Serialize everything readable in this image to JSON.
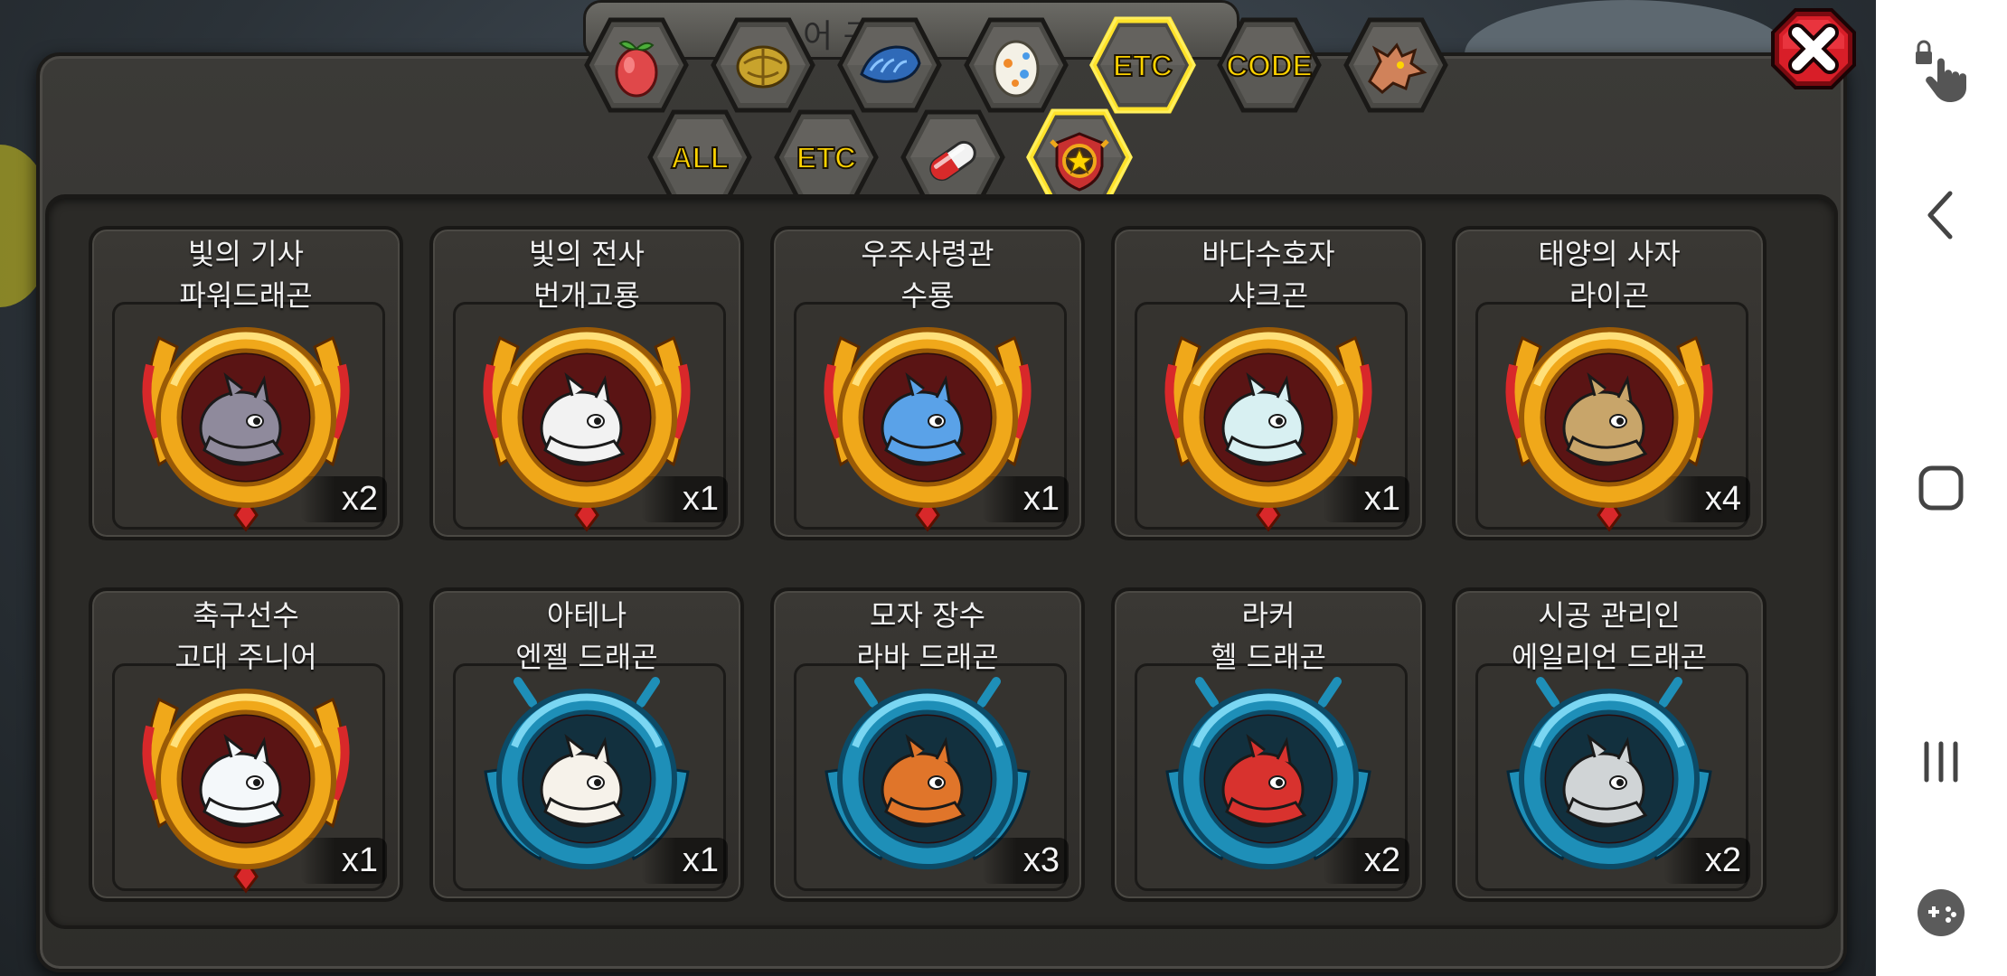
{
  "header_partial_text": "어 구",
  "tabs_row1": [
    {
      "name": "tab-fruit",
      "icon": "fruit-icon",
      "label": "",
      "selected": false
    },
    {
      "name": "tab-nuts",
      "icon": "nuts-icon",
      "label": "",
      "selected": false
    },
    {
      "name": "tab-scales",
      "icon": "scales-icon",
      "label": "",
      "selected": false
    },
    {
      "name": "tab-egg",
      "icon": "egg-icon",
      "label": "",
      "selected": false
    },
    {
      "name": "tab-etc-top",
      "icon": "",
      "label": "ETC",
      "selected": true
    },
    {
      "name": "tab-code",
      "icon": "",
      "label": "CODE",
      "selected": false
    },
    {
      "name": "tab-dragon",
      "icon": "dragon-head-icon",
      "label": "",
      "selected": false
    }
  ],
  "tabs_row2": [
    {
      "name": "tab-all",
      "icon": "",
      "label": "ALL",
      "selected": false
    },
    {
      "name": "tab-etc",
      "icon": "",
      "label": "ETC",
      "selected": false
    },
    {
      "name": "tab-capsule",
      "icon": "capsule-icon",
      "label": "",
      "selected": false
    },
    {
      "name": "tab-star-badge",
      "icon": "star-badge-icon",
      "label": "",
      "selected": true
    }
  ],
  "items": [
    {
      "title": "빛의 기사",
      "subtitle": "파워드래곤",
      "count": "x2",
      "frame": "gold",
      "creature_color": "#8f8a9c"
    },
    {
      "title": "빛의 전사",
      "subtitle": "번개고룡",
      "count": "x1",
      "frame": "gold",
      "creature_color": "#f2f2f2"
    },
    {
      "title": "우주사령관",
      "subtitle": "수룡",
      "count": "x1",
      "frame": "gold",
      "creature_color": "#5aa2e8"
    },
    {
      "title": "바다수호자",
      "subtitle": "샤크곤",
      "count": "x1",
      "frame": "gold",
      "creature_color": "#d8f0f2"
    },
    {
      "title": "태양의 사자",
      "subtitle": "라이곤",
      "count": "x4",
      "frame": "gold",
      "creature_color": "#c8a56a"
    },
    {
      "title": "축구선수",
      "subtitle": "고대 주니어",
      "count": "x1",
      "frame": "gold",
      "creature_color": "#f4f8fa"
    },
    {
      "title": "아테나",
      "subtitle": "엔젤 드래곤",
      "count": "x1",
      "frame": "blue",
      "creature_color": "#f6f2ea"
    },
    {
      "title": "모자 장수",
      "subtitle": "라바 드래곤",
      "count": "x3",
      "frame": "blue",
      "creature_color": "#e0752a"
    },
    {
      "title": "라커",
      "subtitle": "헬 드래곤",
      "count": "x2",
      "frame": "blue",
      "creature_color": "#d8322e"
    },
    {
      "title": "시공 관리인",
      "subtitle": "에일리언 드래곤",
      "count": "x2",
      "frame": "blue",
      "creature_color": "#d0d4d6"
    }
  ],
  "colors": {
    "gold_frame": "#f0a81a",
    "blue_frame": "#1e8fb8",
    "selected_glow": "#ffe22a",
    "close_red": "#d81e28"
  },
  "nav": [
    {
      "name": "touch-lock-icon"
    },
    {
      "name": "back-icon"
    },
    {
      "name": "home-icon"
    },
    {
      "name": "recents-icon"
    },
    {
      "name": "game-tools-icon"
    }
  ]
}
